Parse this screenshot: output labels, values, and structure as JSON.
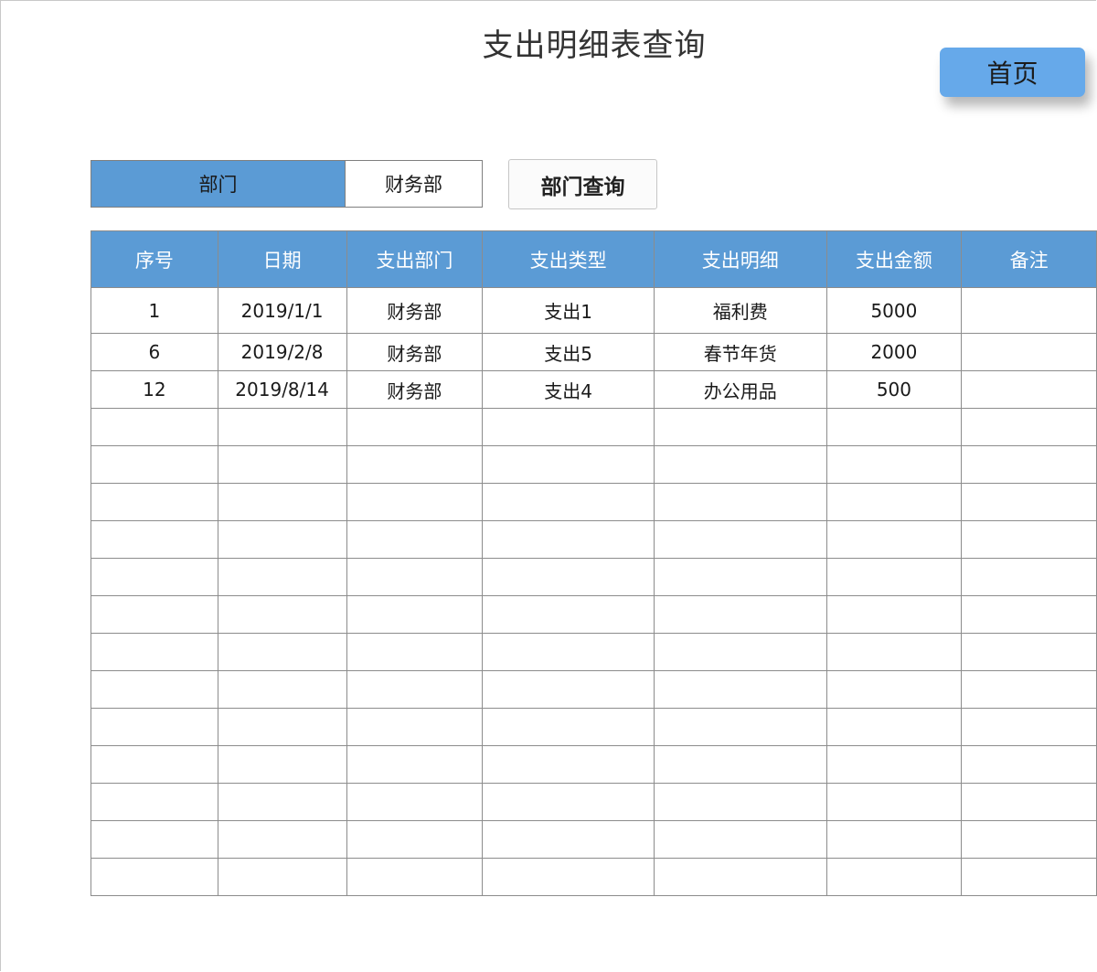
{
  "page": {
    "title": "支出明细表查询",
    "home_button": "首页"
  },
  "filter": {
    "label": "部门",
    "value": "财务部",
    "query_button": "部门查询"
  },
  "table": {
    "columns": [
      "序号",
      "日期",
      "支出部门",
      "支出类型",
      "支出明细",
      "支出金额",
      "备注"
    ],
    "rows": [
      [
        "1",
        "2019/1/1",
        "财务部",
        "支出1",
        "福利费",
        "5000",
        ""
      ],
      [
        "6",
        "2019/2/8",
        "财务部",
        "支出5",
        "春节年货",
        "2000",
        ""
      ],
      [
        "12",
        "2019/8/14",
        "财务部",
        "支出4",
        "办公用品",
        "500",
        ""
      ]
    ],
    "empty_row_count": 13
  },
  "colors": {
    "header_blue": "#5b9bd5",
    "home_button_blue": "#66a9ea"
  }
}
